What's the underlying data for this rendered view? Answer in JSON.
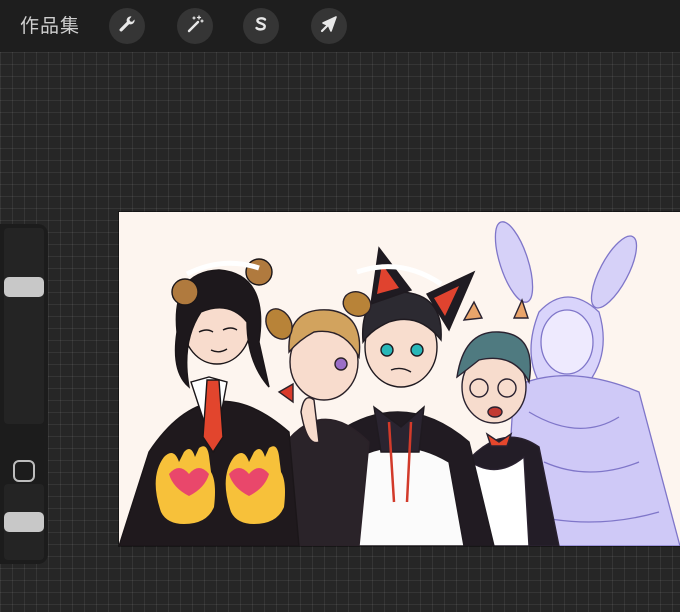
{
  "toolbar": {
    "gallery_label": "作品集",
    "tools": [
      {
        "icon": "wrench-icon",
        "name": "actions"
      },
      {
        "icon": "magic-wand-icon",
        "name": "adjustments"
      },
      {
        "icon": "selection-s-icon",
        "name": "selection"
      },
      {
        "icon": "arrow-cursor-icon",
        "name": "transform"
      }
    ]
  },
  "sidebar": {
    "brush_size_level": 0.72,
    "opacity_level": 0.5,
    "modify_icon": "square-icon"
  },
  "canvas": {
    "artwork": "maid-cafe-group-illustration",
    "emoji": [
      "heart-hands-emoji",
      "heart-hands-emoji"
    ]
  },
  "colors": {
    "toolbar_bg": "#1e1e1e",
    "canvas_bg": "#fdf5ef",
    "sketch_lavender": "#c9c3f5"
  }
}
